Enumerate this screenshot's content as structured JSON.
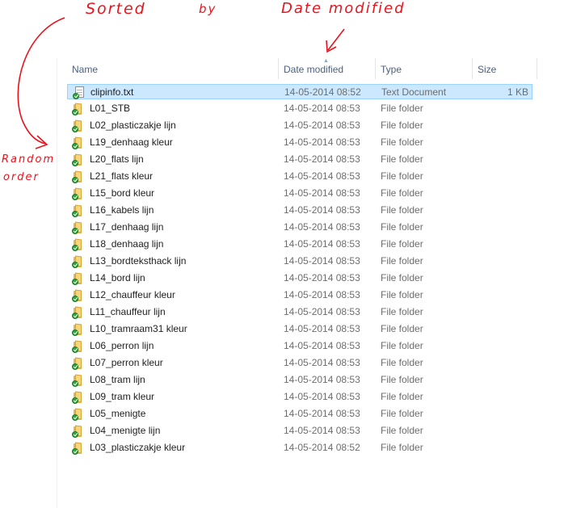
{
  "annotations": {
    "sorted_by": "Sorted  by  Date modified",
    "sorted_word": "Sorted",
    "by_word": "by",
    "date_modified_word": "Date  modified",
    "random_order_line1": "Random",
    "random_order_line2": "order",
    "color": "#e8141c"
  },
  "columns": {
    "name": "Name",
    "date": "Date modified",
    "type": "Type",
    "size": "Size",
    "sorted_column": "date"
  },
  "files": [
    {
      "name": "clipinfo.txt",
      "date": "14-05-2014 08:52",
      "type": "Text Document",
      "size": "1 KB",
      "icon": "text-document-icon",
      "selected": true
    },
    {
      "name": "L01_STB",
      "date": "14-05-2014 08:53",
      "type": "File folder",
      "size": "",
      "icon": "folder-icon"
    },
    {
      "name": "L02_plasticzakje lijn",
      "date": "14-05-2014 08:53",
      "type": "File folder",
      "size": "",
      "icon": "folder-icon"
    },
    {
      "name": "L19_denhaag kleur",
      "date": "14-05-2014 08:53",
      "type": "File folder",
      "size": "",
      "icon": "folder-icon"
    },
    {
      "name": "L20_flats lijn",
      "date": "14-05-2014 08:53",
      "type": "File folder",
      "size": "",
      "icon": "folder-icon"
    },
    {
      "name": "L21_flats kleur",
      "date": "14-05-2014 08:53",
      "type": "File folder",
      "size": "",
      "icon": "folder-icon"
    },
    {
      "name": "L15_bord kleur",
      "date": "14-05-2014 08:53",
      "type": "File folder",
      "size": "",
      "icon": "folder-icon"
    },
    {
      "name": "L16_kabels lijn",
      "date": "14-05-2014 08:53",
      "type": "File folder",
      "size": "",
      "icon": "folder-icon"
    },
    {
      "name": "L17_denhaag lijn",
      "date": "14-05-2014 08:53",
      "type": "File folder",
      "size": "",
      "icon": "folder-icon"
    },
    {
      "name": "L18_denhaag lijn",
      "date": "14-05-2014 08:53",
      "type": "File folder",
      "size": "",
      "icon": "folder-icon"
    },
    {
      "name": "L13_bordteksthack lijn",
      "date": "14-05-2014 08:53",
      "type": "File folder",
      "size": "",
      "icon": "folder-icon"
    },
    {
      "name": "L14_bord lijn",
      "date": "14-05-2014 08:53",
      "type": "File folder",
      "size": "",
      "icon": "folder-icon"
    },
    {
      "name": "L12_chauffeur kleur",
      "date": "14-05-2014 08:53",
      "type": "File folder",
      "size": "",
      "icon": "folder-icon"
    },
    {
      "name": "L11_chauffeur lijn",
      "date": "14-05-2014 08:53",
      "type": "File folder",
      "size": "",
      "icon": "folder-icon"
    },
    {
      "name": "L10_tramraam31 kleur",
      "date": "14-05-2014 08:53",
      "type": "File folder",
      "size": "",
      "icon": "folder-icon"
    },
    {
      "name": "L06_perron lijn",
      "date": "14-05-2014 08:53",
      "type": "File folder",
      "size": "",
      "icon": "folder-icon"
    },
    {
      "name": "L07_perron kleur",
      "date": "14-05-2014 08:53",
      "type": "File folder",
      "size": "",
      "icon": "folder-icon"
    },
    {
      "name": "L08_tram lijn",
      "date": "14-05-2014 08:53",
      "type": "File folder",
      "size": "",
      "icon": "folder-icon"
    },
    {
      "name": "L09_tram kleur",
      "date": "14-05-2014 08:53",
      "type": "File folder",
      "size": "",
      "icon": "folder-icon"
    },
    {
      "name": "L05_menigte",
      "date": "14-05-2014 08:53",
      "type": "File folder",
      "size": "",
      "icon": "folder-icon"
    },
    {
      "name": "L04_menigte lijn",
      "date": "14-05-2014 08:53",
      "type": "File folder",
      "size": "",
      "icon": "folder-icon"
    },
    {
      "name": "L03_plasticzakje kleur",
      "date": "14-05-2014 08:52",
      "type": "File folder",
      "size": "",
      "icon": "folder-icon"
    }
  ]
}
